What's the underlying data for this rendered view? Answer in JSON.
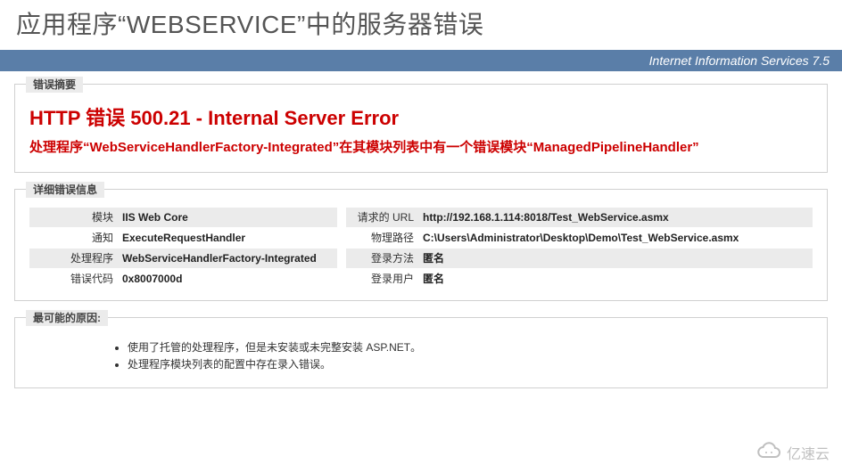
{
  "header": {
    "page_title": "应用程序“WEBSERVICE”中的服务器错误",
    "iis_banner": "Internet Information Services 7.5"
  },
  "summary": {
    "legend": "错误摘要",
    "title": "HTTP 错误 500.21 - Internal Server Error",
    "subtitle": "处理程序“WebServiceHandlerFactory-Integrated”在其模块列表中有一个错误模块“ManagedPipelineHandler”"
  },
  "details": {
    "legend": "详细错误信息",
    "left": [
      {
        "label": "模块",
        "value": "IIS Web Core"
      },
      {
        "label": "通知",
        "value": "ExecuteRequestHandler"
      },
      {
        "label": "处理程序",
        "value": "WebServiceHandlerFactory-Integrated"
      },
      {
        "label": "错误代码",
        "value": "0x8007000d"
      }
    ],
    "right": [
      {
        "label": "请求的 URL",
        "value": "http://192.168.1.114:8018/Test_WebService.asmx"
      },
      {
        "label": "物理路径",
        "value": "C:\\Users\\Administrator\\Desktop\\Demo\\Test_WebService.asmx"
      },
      {
        "label": "登录方法",
        "value": "匿名"
      },
      {
        "label": "登录用户",
        "value": "匿名"
      }
    ]
  },
  "causes": {
    "legend": "最可能的原因:",
    "items": [
      "使用了托管的处理程序，但是未安装或未完整安装 ASP.NET。",
      "处理程序模块列表的配置中存在录入错误。"
    ]
  },
  "watermark": {
    "text": "亿速云"
  }
}
